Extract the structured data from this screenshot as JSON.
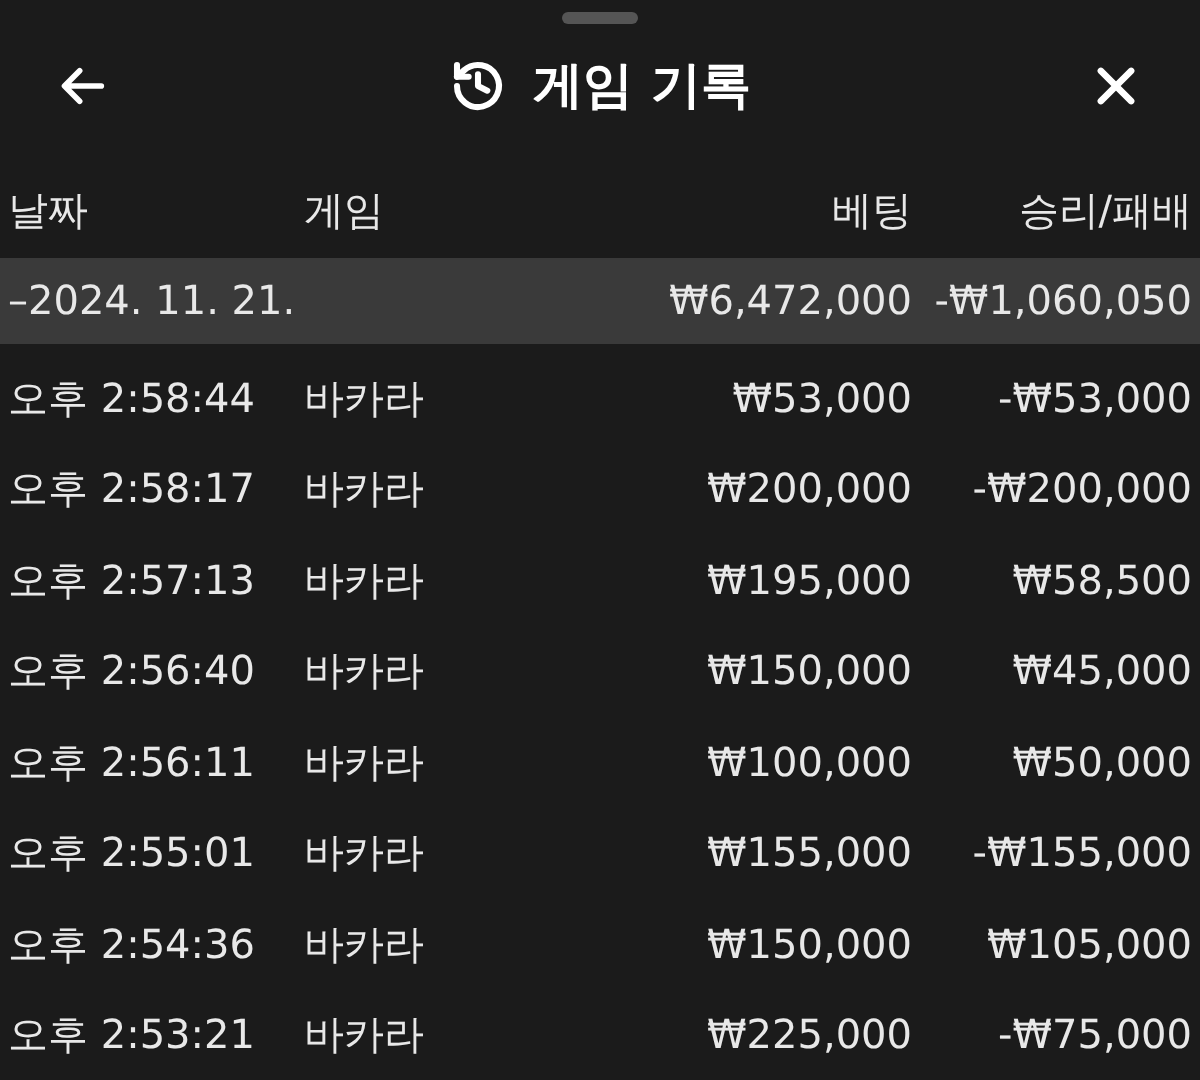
{
  "header": {
    "title": "게임 기록"
  },
  "columns": [
    "날짜",
    "게임",
    "베팅",
    "승리/패배"
  ],
  "group": {
    "date": "–2024. 11. 21.",
    "bet": "₩6,472,000",
    "result": "-₩1,060,050"
  },
  "rows": [
    {
      "time": "오후 2:58:44",
      "game": "바카라",
      "bet": "₩53,000",
      "result": "-₩53,000"
    },
    {
      "time": "오후 2:58:17",
      "game": "바카라",
      "bet": "₩200,000",
      "result": "-₩200,000"
    },
    {
      "time": "오후 2:57:13",
      "game": "바카라",
      "bet": "₩195,000",
      "result": "₩58,500"
    },
    {
      "time": "오후 2:56:40",
      "game": "바카라",
      "bet": "₩150,000",
      "result": "₩45,000"
    },
    {
      "time": "오후 2:56:11",
      "game": "바카라",
      "bet": "₩100,000",
      "result": "₩50,000"
    },
    {
      "time": "오후 2:55:01",
      "game": "바카라",
      "bet": "₩155,000",
      "result": "-₩155,000"
    },
    {
      "time": "오후 2:54:36",
      "game": "바카라",
      "bet": "₩150,000",
      "result": "₩105,000"
    },
    {
      "time": "오후 2:53:21",
      "game": "바카라",
      "bet": "₩225,000",
      "result": "-₩75,000"
    }
  ]
}
